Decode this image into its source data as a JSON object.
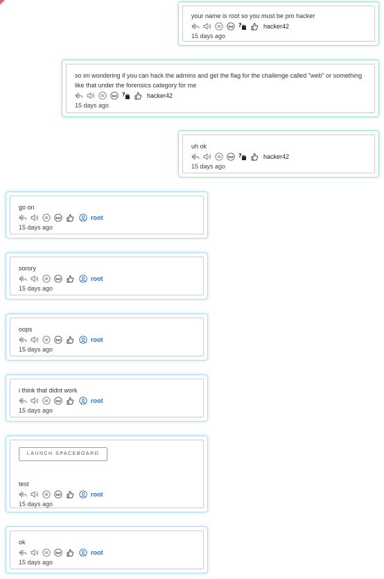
{
  "messages": [
    {
      "text": "your name is root so you must be pro hacker",
      "author": "hacker42",
      "time": "15 days ago"
    },
    {
      "text": "so im wondering if you can hack the admins and get the flag for the challenge called \"web\" or something like that under the forensics category for me",
      "author": "hacker42",
      "time": "15 days ago"
    },
    {
      "text": "uh ok",
      "author": "hacker42",
      "time": "15 days ago"
    },
    {
      "text": "go on",
      "author": "root",
      "time": "15 days ago"
    },
    {
      "text": "sorory",
      "author": "root",
      "time": "15 days ago"
    },
    {
      "text": "oops",
      "author": "root",
      "time": "15 days ago"
    },
    {
      "text": "i think that didnt work",
      "author": "root",
      "time": "15 days ago"
    },
    {
      "button": "LAUNCH SPACEBOARD",
      "text": "test",
      "author": "root",
      "time": "15 days ago"
    },
    {
      "text": "ok",
      "author": "root",
      "time": "15 days ago"
    }
  ],
  "icons": [
    "reply-icon",
    "speaker-icon",
    "transcript-icon",
    "interpret-icon",
    "hand-gesture-icon",
    "thumbs-up-icon",
    "user-icon"
  ],
  "colors": {
    "hacker_border": "#9fe3ba",
    "root_border": "#a9dff0",
    "root_name": "#2a6dc0"
  }
}
